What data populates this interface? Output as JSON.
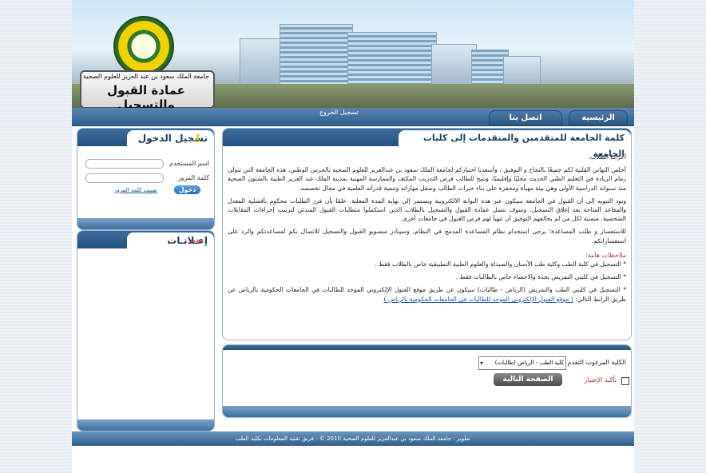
{
  "header": {
    "logo_line1": "جامعة الملك سعود بن عبد العزيز للعلوم الصحية",
    "logo_line2": "عمادة القبول والتسجيل",
    "login_mini": "تسجيل الخروج"
  },
  "nav": {
    "items": [
      {
        "label": "الرئيسية"
      },
      {
        "label": "اتصل بنا"
      }
    ]
  },
  "login": {
    "title": "تسجيل الدخول",
    "username_label": "اسم المستخدم",
    "password_label": "كلمة المرور",
    "login_button": "دخول",
    "forgot_link": "نسيت كلمة المرور"
  },
  "ads": {
    "title": "إعـلانـات",
    "badge": "جديد"
  },
  "content": {
    "title": "كلمة الجامعة للمتقدمين والمتقدمات إلى كليات الجامعة",
    "greeting": "أعزائنا الطلاب،",
    "paragraph1": "أخلص التهاني القلبية لكم جميعًا بالنجاح و التوفيق ، وأسعدنا اختياركم لجامعة الملك سعود بن عبدالعزيز للعلوم الصحية بالحرس الوطني، هذه الجامعة التي تتولى زمام الريادة في التعليم الطبي الحديث محليًا وإقليميًا، وتتيح للطالب فرص التدريب المكثف والممارسة المهنية بمدينة الملك عبد العزيز الطبية بالشئون الصحية منذ سنواته الدراسية الأولى وهي بيئة مهيأة ومحفزة على بناء خبرات الطالب وصقل مهاراته وتنمية قدراته العلمية في مجال تخصصه.",
    "paragraph2": "وتود التنويه إلى أن القبول في الجامعة سيكون عبر هذه البوابة الالكترونية ويستمر إلى نهاية المدة المعلنة. علمًا بأن فرز الطلبات محكوم بأفضلية المعدل والمقاعد المتاحة بعد إغلاق التسجيل، وسوف تتصل عمادة القبول والتسجيل بالطلاب الذين استكملوا متطلبات القبول المبدئي لترتيب إجراءات المقابلات الشخصية. متمنية لكل من لم يحالفهم التوفيق أن تتهيأ لهم فرص القبول في جامعات أخرى.",
    "paragraph3": "للاستفسار و طلب المساعدة؛ يرجى استخدام نظام المساعدة المدمج في النظام، وسيبادر منسوبو القبول والتسجيل للاتصال بكم لمساعدتكم والرد على استفساراتكم.",
    "notes_title": "ملاحظات هامة:",
    "note1": "* التسجيل في كلية الطب وكلية طب الأسنان والصيدلة والعلوم الطبية التطبيقية خاص بالطلاب فقط .",
    "note2": "* التسجيل في كليتي التمريض بجدة والاحساء خاص بالطالبات فقط .",
    "note3": "* التسجيل في كليتي الطب والتمريض (الرياض - طالبات) سيكون عن طريق موقع القبول الإلكتروني الموحد للطالبات في الجامعات الحكومية بالرياض عن طريق الرابط التالي:",
    "notes_link": "( موقع القبول الإلكتروني الموحد للطالبات في الجامعات الحكومية بالرياض )"
  },
  "form": {
    "college_label": "الكلية المرغوب التقدم لها",
    "selected_college": "كلية الطب - الرياض (طالبات)",
    "confirm_label": "تأكيد الإختيار",
    "next_button": "الصفحة التالية"
  },
  "footer": {
    "text": "تطوير : جامعة الملك سعود بن عبدالعزيز للعلوم الصحية 2010 © - فريق تقنية المعلومات بكلية الطب"
  }
}
